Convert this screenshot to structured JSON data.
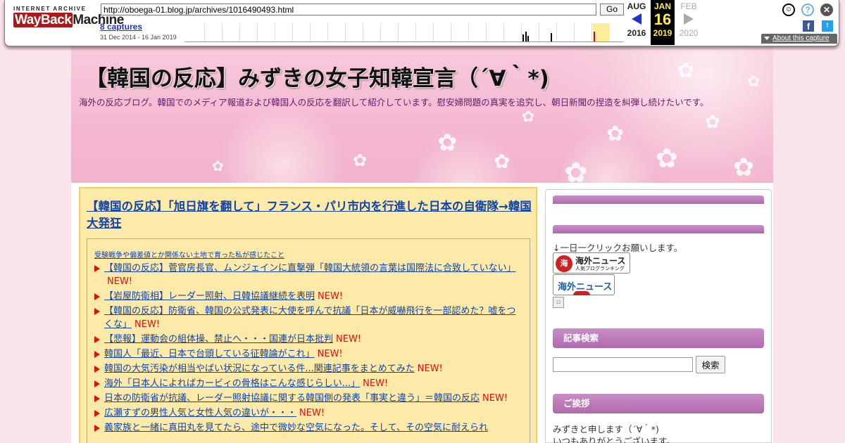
{
  "wayback": {
    "logo_top": "INTERNET ARCHIVE",
    "logo_way": "WayBack",
    "logo_machine": "Machine",
    "url": "http://oboega-01.blog.jp/archives/1016490493.html",
    "go_label": "Go",
    "captures": "8 captures",
    "date_range": "31 Dec 2014 - 16 Jan 2019",
    "prev": {
      "month": "AUG",
      "year": "2016"
    },
    "current": {
      "month": "JAN",
      "day": "16",
      "year": "2019"
    },
    "next": {
      "month": "FEB",
      "year": "2020"
    },
    "about": "About this capture",
    "fb_glyph": "f",
    "tw_glyph": "t",
    "user_glyph": "☺",
    "help_glyph": "?",
    "close_glyph": "✕"
  },
  "blog": {
    "title": "【韓国の反応】みずきの女子知韓宣言（´∀｀*)",
    "description": "海外の反応ブログ。韓国でのメディア報道および韓国人の反応を翻訳して紹介しています。慰安婦問題の真実を追究し、朝日新聞の捏造を糾弾し続けたいです。"
  },
  "article": {
    "title": "【韓国の反応】「旭日旗を翻して」フランス・パリ市内を行進した日本の自衛隊→韓国大発狂",
    "related_heading": "受験戦争や偏差値とか関係ない土地で育った私が感じたこと",
    "related": [
      {
        "text": "【韓国の反応】菅官房長官、ムンジェインに直撃弾「韓国大統領の言葉は国際法に合致していない」",
        "new": "NEW!"
      },
      {
        "text": "【岩屋防衛相】レーダー照射、日韓協議継続を表明",
        "new": "NEW!"
      },
      {
        "text": "【韓国の反応】防衛省、韓国の公式発表に大使を呼んで抗議「日本が威嚇飛行を一部認めた？嘘をつくな」",
        "new": "NEW!"
      },
      {
        "text": "【悲報】運動会の組体操、禁止へ・・・国連が日本批判",
        "new": "NEW!"
      },
      {
        "text": "韓国人「最近、日本で台頭している征韓論がこれ」",
        "new": "NEW!"
      },
      {
        "text": "韓国の大気汚染が相当やばい状況になっている件...関連記事をまとめてみた",
        "new": "NEW!"
      },
      {
        "text": "海外「日本人によればカービィの骨格はこんな感じらしい...」",
        "new": "NEW!"
      },
      {
        "text": "日本の防衛省が抗議、レーダー照射協議に関する韓国側の発表「事実と違う」＝韓国の反応",
        "new": "NEW!"
      },
      {
        "text": "広瀬すずの男性人気と女性人気の違いが・・・",
        "new": "NEW!"
      },
      {
        "text": "義家族と一緒に真田丸を見てたら、途中で微妙な空気になった。そして、その空気に耐えられ",
        "new": ""
      }
    ]
  },
  "sidebar": {
    "click_request": "↓一日一クリックお願いします。",
    "rank1_title": "海外ニュース",
    "rank1_sub": "人気ブログランキング",
    "rank1_badge": "海",
    "rank2_title": "海外ニュース",
    "search_heading": "記事検索",
    "search_placeholder": "",
    "search_button": "検索",
    "greeting_heading": "ご挨拶",
    "greeting_line1": "みずきと申します（´∀｀*)",
    "greeting_line2": "いつもありがとうございます。"
  }
}
